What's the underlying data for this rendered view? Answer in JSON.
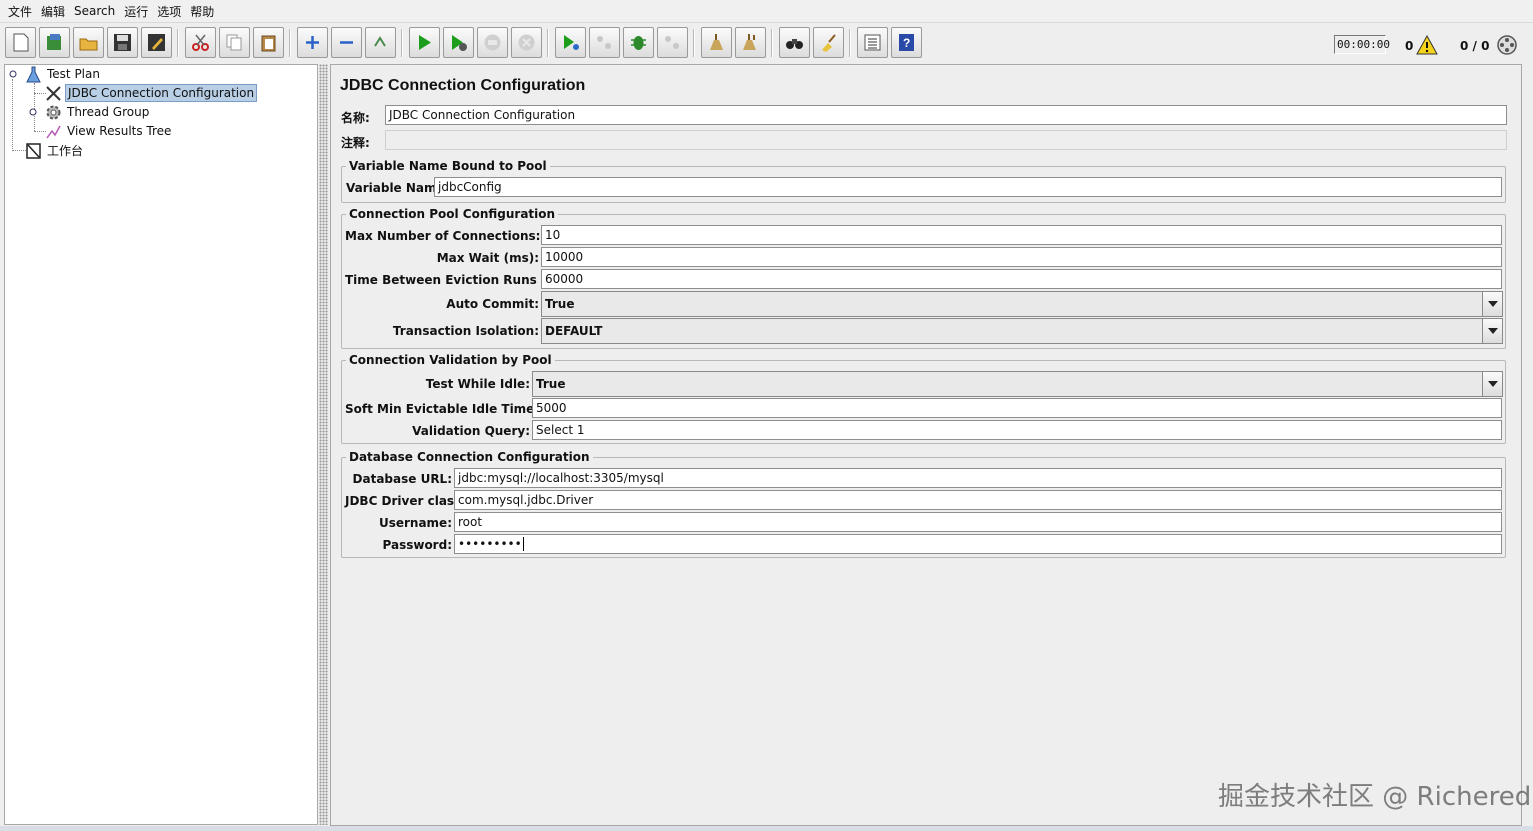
{
  "menu": [
    "文件",
    "编辑",
    "Search",
    "运行",
    "选项",
    "帮助"
  ],
  "toolbar": {
    "icons": [
      "new-icon",
      "templates-icon",
      "open-icon",
      "save-icon",
      "save-as-icon",
      "cut-icon",
      "copy-icon",
      "paste-icon",
      "expand-icon",
      "collapse-icon",
      "toggle-icon",
      "start-icon",
      "start-no-pause-icon",
      "stop-icon",
      "shutdown-icon",
      "remote-start-icon",
      "remote-stop-icon",
      "remote-debug-icon",
      "remote-exit-icon",
      "clear-icon",
      "clear-all-icon",
      "search-icon",
      "reset-search-icon",
      "function-helper-icon",
      "help-icon"
    ],
    "timer": "00:00:00",
    "error_count": "0",
    "threads": "0 / 0"
  },
  "tree": {
    "test_plan": "Test Plan",
    "jdbc_config": "JDBC Connection Configuration",
    "thread_group": "Thread Group",
    "view_results": "View Results Tree",
    "workbench": "工作台"
  },
  "main": {
    "title": "JDBC Connection Configuration",
    "name_label": "名称:",
    "name_value": "JDBC Connection Configuration",
    "comment_label": "注释:",
    "comment_value": "",
    "variable_group": {
      "title": "Variable Name Bound to Pool",
      "label": "Variable Name:",
      "value": "jdbcConfig"
    },
    "pool_group": {
      "title": "Connection Pool Configuration",
      "max_conn_label": "Max Number of Connections:",
      "max_conn_value": "10",
      "max_wait_label": "Max Wait (ms):",
      "max_wait_value": "10000",
      "eviction_label": "Time Between Eviction Runs (ms):",
      "eviction_value": "60000",
      "auto_commit_label": "Auto Commit:",
      "auto_commit_value": "True",
      "isolation_label": "Transaction Isolation:",
      "isolation_value": "DEFAULT"
    },
    "validation_group": {
      "title": "Connection Validation by Pool",
      "test_idle_label": "Test While Idle:",
      "test_idle_value": "True",
      "soft_min_label": "Soft Min Evictable Idle Time(ms):",
      "soft_min_value": "5000",
      "query_label": "Validation Query:",
      "query_value": "Select 1"
    },
    "db_group": {
      "title": "Database Connection Configuration",
      "url_label": "Database URL:",
      "url_value": "jdbc:mysql://localhost:3305/mysql",
      "driver_label": "JDBC Driver class:",
      "driver_value": "com.mysql.jdbc.Driver",
      "user_label": "Username:",
      "user_value": "root",
      "pass_label": "Password:",
      "pass_value": "•••••••••"
    }
  },
  "watermark": "掘金技术社区 @ Richered"
}
